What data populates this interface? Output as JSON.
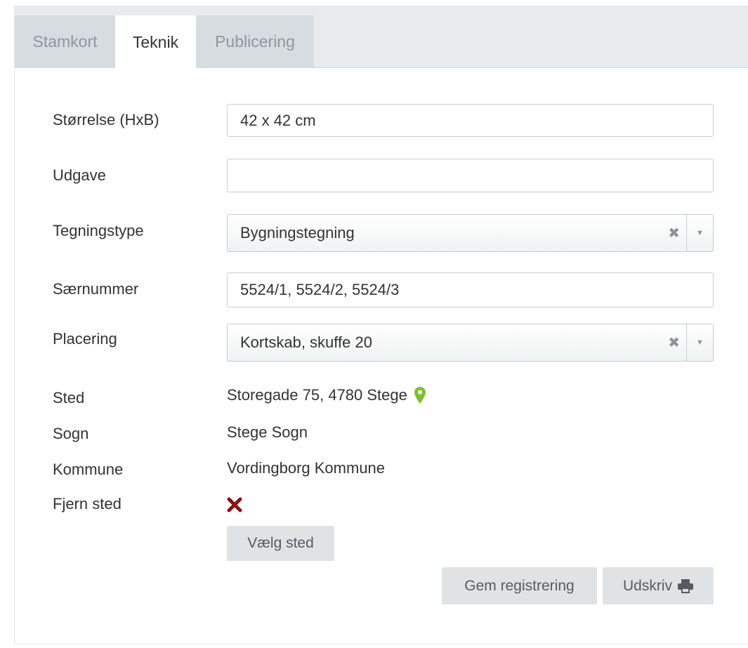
{
  "tabs": [
    {
      "label": "Stamkort"
    },
    {
      "label": "Teknik"
    },
    {
      "label": "Publicering"
    }
  ],
  "form": {
    "size_label": "Størrelse (HxB)",
    "size_value": "42 x 42 cm",
    "edition_label": "Udgave",
    "edition_value": "",
    "drawing_type_label": "Tegningstype",
    "drawing_type_value": "Bygningstegning",
    "special_number_label": "Særnummer",
    "special_number_value": "5524/1, 5524/2, 5524/3",
    "placement_label": "Placering",
    "placement_value": "Kortskab, skuffe 20",
    "place_label": "Sted",
    "place_value": "Storegade 75, 4780 Stege",
    "parish_label": "Sogn",
    "parish_value": "Stege Sogn",
    "municipality_label": "Kommune",
    "municipality_value": "Vordingborg Kommune",
    "remove_place_label": "Fjern sted"
  },
  "buttons": {
    "choose_place": "Vælg sted",
    "save_registration": "Gem registrering",
    "print": "Udskriv"
  },
  "icons": {
    "clear": "clear-icon",
    "dropdown": "chevron-down-icon",
    "map_pin": "map-pin-icon",
    "remove": "remove-x-icon",
    "print": "printer-icon"
  },
  "colors": {
    "pin": "#7cc02a",
    "remove": "#8b1010",
    "tab_active": "#ffffff",
    "tab_inactive": "#d7dce1",
    "button": "#dfe3e6"
  }
}
